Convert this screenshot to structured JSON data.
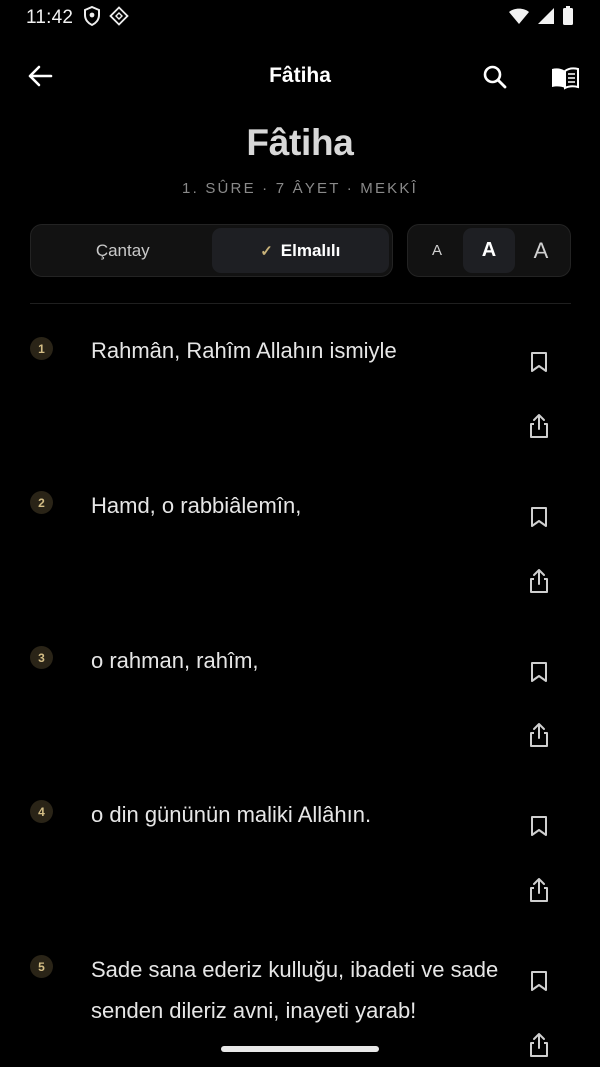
{
  "status_bar": {
    "time": "11:42"
  },
  "app_bar": {
    "title": "Fâtiha"
  },
  "surah": {
    "name": "Fâtiha",
    "meta": "1. SÛRE · 7 ÂYET · MEKKÎ"
  },
  "translators": {
    "options": [
      "Çantay",
      "Elmalılı"
    ],
    "selected": "Elmalılı",
    "check_glyph": "✓"
  },
  "font_sizes": {
    "options": [
      "A",
      "A",
      "A"
    ],
    "selected_index": 1
  },
  "verses": [
    {
      "number": "1",
      "text": "Rahmân, Rahîm Allahın ismiyle"
    },
    {
      "number": "2",
      "text": "Hamd, o rabbiâlemîn,"
    },
    {
      "number": "3",
      "text": "o rahman, rahîm,"
    },
    {
      "number": "4",
      "text": "o din gününün maliki Allâhın."
    },
    {
      "number": "5",
      "text": "Sade sana ederiz kulluğu, ibadeti ve sade senden dileriz avni, inayeti yarab!"
    }
  ],
  "icons": {
    "back": "arrow-back-icon",
    "search": "search-icon",
    "book": "open-book-icon",
    "bookmark": "bookmark-icon",
    "share": "share-icon"
  },
  "colors": {
    "background": "#000000",
    "accent": "#d4be86",
    "text": "#e6e6e6",
    "muted": "#8a8a8a"
  }
}
